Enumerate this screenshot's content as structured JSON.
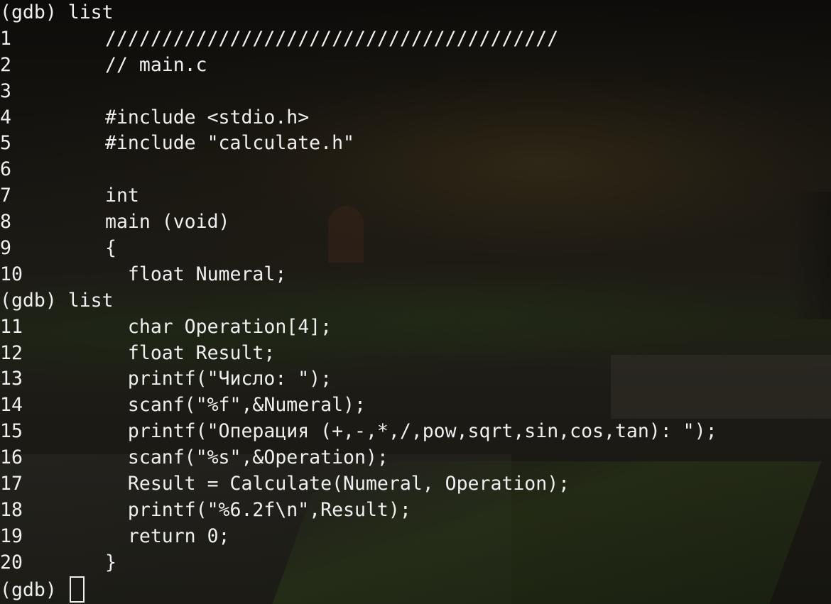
{
  "terminal": {
    "lines": [
      {
        "kind": "prompt",
        "prompt": "(gdb)",
        "command": " list"
      },
      {
        "kind": "code",
        "num": "1",
        "code": "////////////////////////////////////////"
      },
      {
        "kind": "code",
        "num": "2",
        "code": "// main.c"
      },
      {
        "kind": "code",
        "num": "3",
        "code": ""
      },
      {
        "kind": "code",
        "num": "4",
        "code": "#include <stdio.h>"
      },
      {
        "kind": "code",
        "num": "5",
        "code": "#include \"calculate.h\""
      },
      {
        "kind": "code",
        "num": "6",
        "code": ""
      },
      {
        "kind": "code",
        "num": "7",
        "code": "int"
      },
      {
        "kind": "code",
        "num": "8",
        "code": "main (void)"
      },
      {
        "kind": "code",
        "num": "9",
        "code": "{"
      },
      {
        "kind": "code",
        "num": "10",
        "code": "  float Numeral;"
      },
      {
        "kind": "prompt",
        "prompt": "(gdb)",
        "command": " list"
      },
      {
        "kind": "code",
        "num": "11",
        "code": "  char Operation[4];"
      },
      {
        "kind": "code",
        "num": "12",
        "code": "  float Result;"
      },
      {
        "kind": "code",
        "num": "13",
        "code": "  printf(\"Число: \");"
      },
      {
        "kind": "code",
        "num": "14",
        "code": "  scanf(\"%f\",&Numeral);"
      },
      {
        "kind": "code",
        "num": "15",
        "code": "  printf(\"Операция (+,-,*,/,pow,sqrt,sin,cos,tan): \");"
      },
      {
        "kind": "code",
        "num": "16",
        "code": "  scanf(\"%s\",&Operation);"
      },
      {
        "kind": "code",
        "num": "17",
        "code": "  Result = Calculate(Numeral, Operation);"
      },
      {
        "kind": "code",
        "num": "18",
        "code": "  printf(\"%6.2f\\n\",Result);"
      },
      {
        "kind": "code",
        "num": "19",
        "code": "  return 0;"
      },
      {
        "kind": "code",
        "num": "20",
        "code": "}"
      },
      {
        "kind": "input",
        "prompt": "(gdb)",
        "command": " "
      }
    ]
  },
  "colors": {
    "text": "#efefef"
  }
}
